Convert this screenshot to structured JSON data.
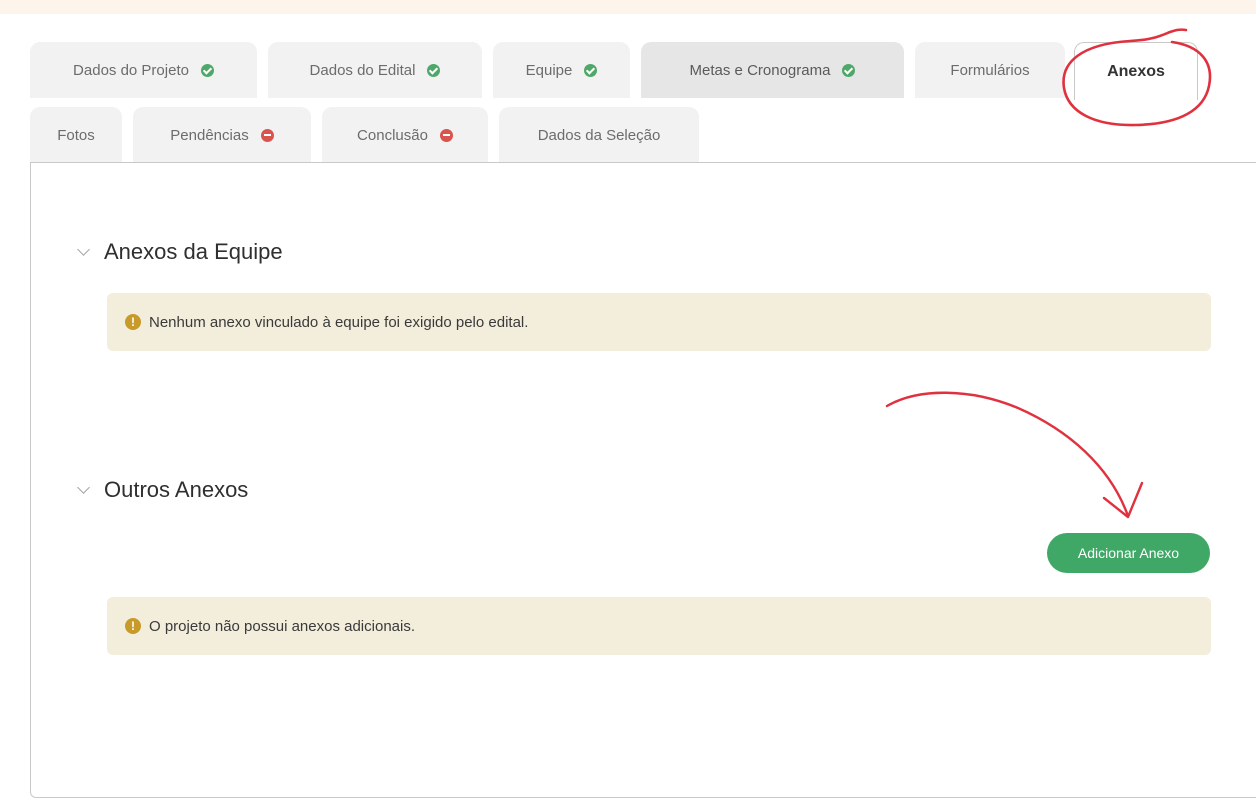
{
  "tabs_row1": [
    {
      "label": "Dados do Projeto",
      "status": "ok"
    },
    {
      "label": "Dados do Edital",
      "status": "ok"
    },
    {
      "label": "Equipe",
      "status": "ok"
    },
    {
      "label": "Metas e Cronograma",
      "status": "ok"
    },
    {
      "label": "Formulários",
      "status": ""
    },
    {
      "label": "Anexos",
      "status": "",
      "active": true
    }
  ],
  "tabs_row2": [
    {
      "label": "Fotos",
      "status": ""
    },
    {
      "label": "Pendências",
      "status": "error"
    },
    {
      "label": "Conclusão",
      "status": "error"
    },
    {
      "label": "Dados da Seleção",
      "status": ""
    }
  ],
  "sections": {
    "equipe": {
      "title": "Anexos da Equipe",
      "alert": "Nenhum anexo vinculado à equipe foi exigido pelo edital."
    },
    "outros": {
      "title": "Outros Anexos",
      "add_button": "Adicionar Anexo",
      "alert": "O projeto não possui anexos adicionais."
    }
  },
  "colors": {
    "success": "#4fa86a",
    "error": "#d9534f",
    "warning": "#c79a2a",
    "alert_bg": "#f3eddc",
    "button": "#3fa866",
    "annotation": "#e0313f"
  },
  "icons": {
    "ok": "check-circle-icon",
    "error": "minus-circle-icon",
    "warning": "exclamation-circle-icon",
    "collapse": "chevron-down-icon"
  }
}
